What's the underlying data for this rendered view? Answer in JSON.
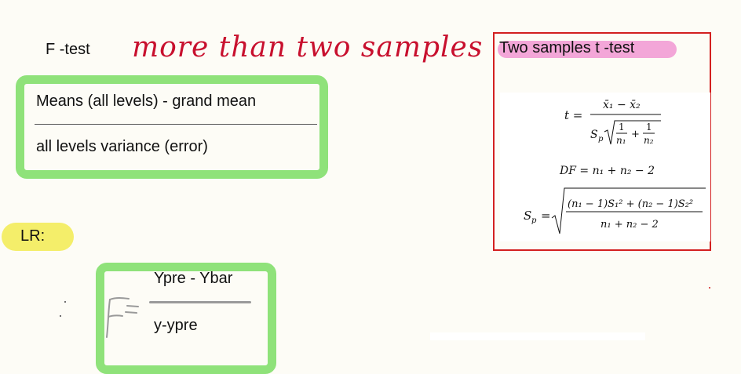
{
  "ftest": {
    "label": "F -test",
    "note": "more than two samples",
    "numerator": "Means (all levels) - grand mean",
    "denominator": "all levels variance (error)"
  },
  "lr": {
    "label": "LR:",
    "f_symbol": "F=",
    "numerator": "Ypre - Ybar",
    "denominator": "y-ypre"
  },
  "ttest": {
    "title": "Two samples t -test",
    "formula": {
      "t_lhs": "t =",
      "t_num": "x̄₁ − x̄₂",
      "sp": "S",
      "sp_sub": "p",
      "one": "1",
      "n1": "n₁",
      "n2": "n₂",
      "plus": "+",
      "df": "DF = n₁ + n₂ − 2",
      "sp_lhs": "S",
      "sp_lhs_sub": "p",
      "eq": "=",
      "sp_num": "(n₁ − 1)S₁² + (n₂ − 1)S₂²",
      "sp_den": "n₁ + n₂ − 2"
    }
  },
  "colors": {
    "green_highlight": "#8fe27a",
    "yellow_highlight": "#f4ee6a",
    "pink_highlight": "#f3a6d8",
    "red_border": "#d32020",
    "handwriting_red": "#c8102e"
  }
}
